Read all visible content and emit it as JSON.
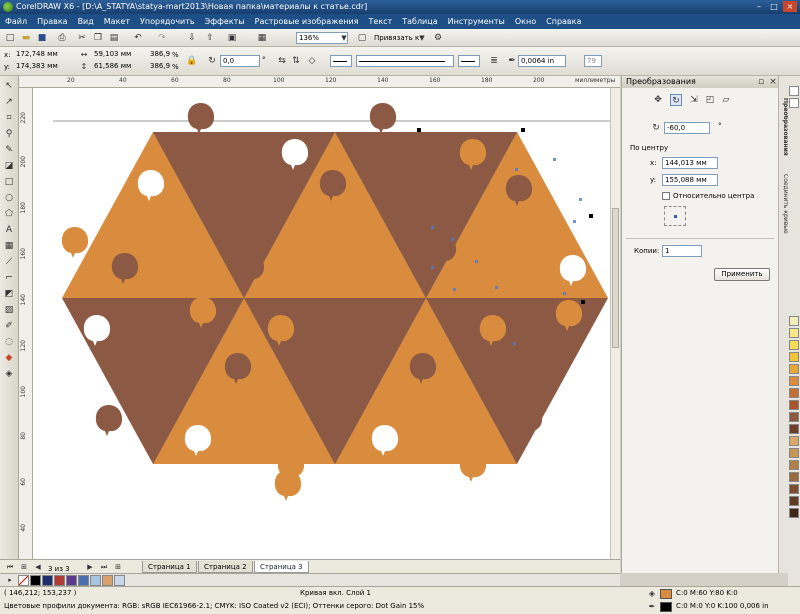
{
  "window": {
    "title": "CorelDRAW X6 - [D:\\A_STATYA\\statya-mart2013\\Новая папка\\материалы к статье.cdr]"
  },
  "menu": [
    "Файл",
    "Правка",
    "Вид",
    "Макет",
    "Упорядочить",
    "Эффекты",
    "Растровые изображения",
    "Текст",
    "Таблица",
    "Инструменты",
    "Окно",
    "Справка"
  ],
  "toolbar": {
    "zoom": "136%",
    "snap_label": "Привязать к"
  },
  "property_bar": {
    "x": "172,748 мм",
    "y": "174,383 мм",
    "width": "59,103 мм",
    "height": "61,586 мм",
    "scale_x": "386,9",
    "scale_y": "386,9",
    "pct": "%",
    "angle": "0,0",
    "outline_width": "0,0064 in",
    "outline_num": "79"
  },
  "ruler": {
    "unit": "миллиметры",
    "h_ticks": [
      "20",
      "40",
      "60",
      "80",
      "100",
      "120",
      "140",
      "160",
      "180",
      "200",
      "220"
    ],
    "v_ticks": [
      "220",
      "200",
      "180",
      "160",
      "140",
      "120",
      "100",
      "80",
      "60",
      "40",
      "20"
    ]
  },
  "docker": {
    "title": "Преобразования",
    "angle": "-60,0",
    "degree_symbol": "°",
    "center_label": "По центру",
    "cx_label": "x:",
    "cx_value": "144,013 мм",
    "cy_label": "y:",
    "cy_value": "155,088 мм",
    "relative_label": "Относительно центра",
    "copies_label": "Копии:",
    "copies_value": "1",
    "apply_label": "Применить",
    "side_tab_1": "Преобразования",
    "side_tab_2": "Соединить кривые"
  },
  "pages": {
    "counter": "3 из 3",
    "tabs": [
      "Страница 1",
      "Страница 2",
      "Страница 3"
    ],
    "active": 2
  },
  "status": {
    "coords": "( 146,212; 153,237 )",
    "layer": "Кривая вкл. Слой 1",
    "color_profiles": "Цветовые профили документа: RGB: sRGB IEC61966-2.1; CMYK: ISO Coated v2 (ECI); Оттенки серого: Dot Gain 15%",
    "fill_info": "C:0 M:60 Y:80 K:0",
    "outline_info": "C:0 M:0 Y:0 K:100  0,006 in"
  },
  "colors": {
    "light": "#d98c3d",
    "dark": "#8c5a44",
    "accent": "#1d4e85"
  }
}
